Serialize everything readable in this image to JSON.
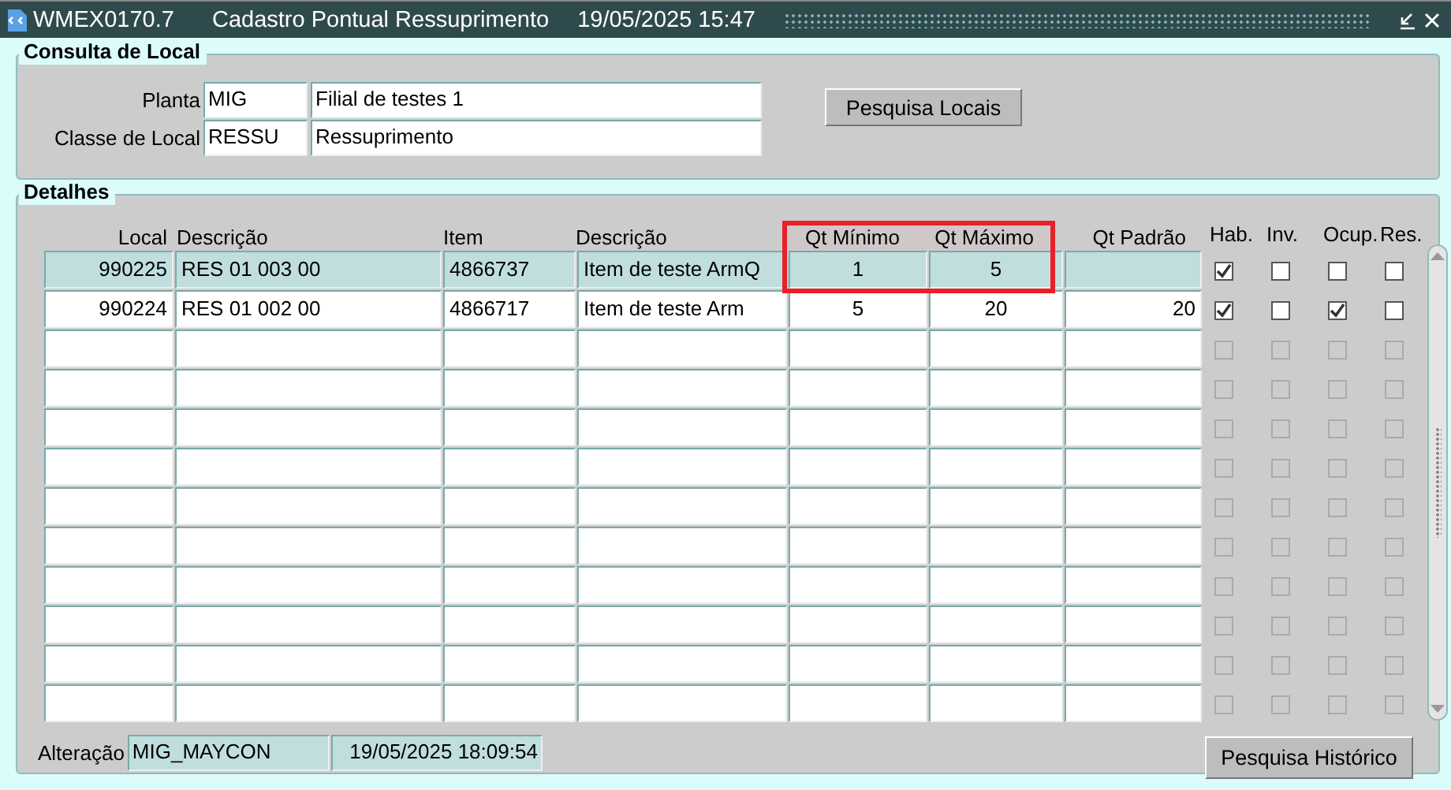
{
  "window": {
    "title": "WMEX0170.7",
    "subtitle": "Cadastro Pontual Ressuprimento",
    "datetime": "19/05/2025 15:47"
  },
  "consulta": {
    "title": "Consulta de Local",
    "fields": [
      {
        "label": "Planta",
        "code": "MIG",
        "description": "Filial de testes 1"
      },
      {
        "label": "Classe de Local",
        "code": "RESSU",
        "description": "Ressuprimento"
      }
    ],
    "button": "Pesquisa Locais"
  },
  "detalhes": {
    "title": "Detalhes",
    "columns": [
      {
        "label": "Local",
        "highlighted": false
      },
      {
        "label": "Descrição",
        "highlighted": false
      },
      {
        "label": "Item",
        "highlighted": false
      },
      {
        "label": "Descrição",
        "highlighted": false
      },
      {
        "label": "Qt Mínimo",
        "highlighted": true
      },
      {
        "label": "Qt Máximo",
        "highlighted": true
      },
      {
        "label": "Qt Padrão",
        "highlighted": false
      }
    ],
    "flag_columns": [
      "Hab.",
      "Inv.",
      "Ocup.",
      "Res."
    ],
    "rows": [
      {
        "kind": "data",
        "selected": true,
        "enabled": true,
        "cells": [
          "990225",
          "RES 01 003 00",
          "4866737",
          "Item de teste ArmQ",
          "1",
          "5",
          ""
        ],
        "flags": [
          true,
          false,
          false,
          false
        ]
      },
      {
        "kind": "data",
        "selected": false,
        "enabled": true,
        "cells": [
          "990224",
          "RES 01 002 00",
          "4866717",
          "Item de teste Arm",
          "5",
          "20",
          "20"
        ],
        "flags": [
          true,
          false,
          true,
          false
        ]
      },
      {
        "kind": "blank",
        "enabled": false,
        "flags": [
          false,
          false,
          false,
          false
        ]
      },
      {
        "kind": "blank",
        "enabled": false,
        "flags": [
          false,
          false,
          false,
          false
        ]
      },
      {
        "kind": "blank",
        "enabled": false,
        "flags": [
          false,
          false,
          false,
          false
        ]
      },
      {
        "kind": "blank",
        "enabled": false,
        "flags": [
          false,
          false,
          false,
          false
        ]
      },
      {
        "kind": "blank",
        "enabled": false,
        "flags": [
          false,
          false,
          false,
          false
        ]
      },
      {
        "kind": "blank",
        "enabled": false,
        "flags": [
          false,
          false,
          false,
          false
        ]
      },
      {
        "kind": "blank",
        "enabled": false,
        "flags": [
          false,
          false,
          false,
          false
        ]
      },
      {
        "kind": "blank",
        "enabled": false,
        "flags": [
          false,
          false,
          false,
          false
        ]
      },
      {
        "kind": "blank",
        "enabled": false,
        "flags": [
          false,
          false,
          false,
          false
        ]
      },
      {
        "kind": "blank",
        "enabled": false,
        "flags": [
          false,
          false,
          false,
          false
        ]
      }
    ],
    "footer": {
      "label": "Alteração",
      "user": "MIG_MAYCON",
      "timestamp": "19/05/2025 18:09:54"
    },
    "button": "Pesquisa Histórico"
  }
}
